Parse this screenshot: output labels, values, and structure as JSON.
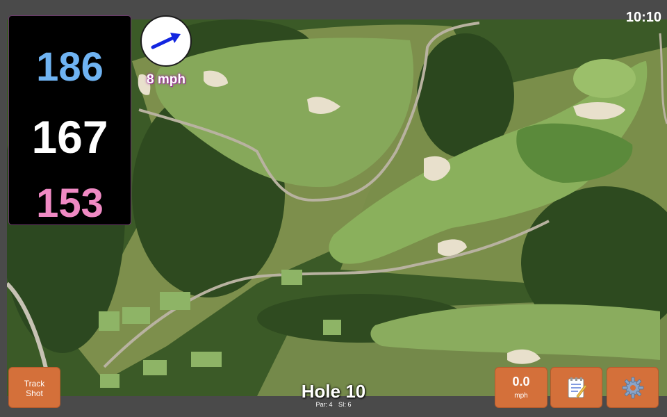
{
  "status": {
    "time": "10:10"
  },
  "distances": {
    "back": "186",
    "middle": "167",
    "front": "153"
  },
  "wind": {
    "speed_label": "8 mph",
    "direction_icon": "arrow-icon"
  },
  "buttons": {
    "track_shot_line1": "Track",
    "track_shot_line2": "Shot",
    "wind_value": "0.0",
    "wind_unit": "mph",
    "notes_icon": "notepad-icon",
    "settings_icon": "gear-icon"
  },
  "hole": {
    "title": "Hole 10",
    "par": "Par: 4",
    "si": "SI: 6"
  },
  "colors": {
    "back_distance": "#6fb3f2",
    "middle_distance": "#ffffff",
    "front_distance": "#f08ac4",
    "button": "#d4703a",
    "wind_arrow": "#1326e0"
  }
}
